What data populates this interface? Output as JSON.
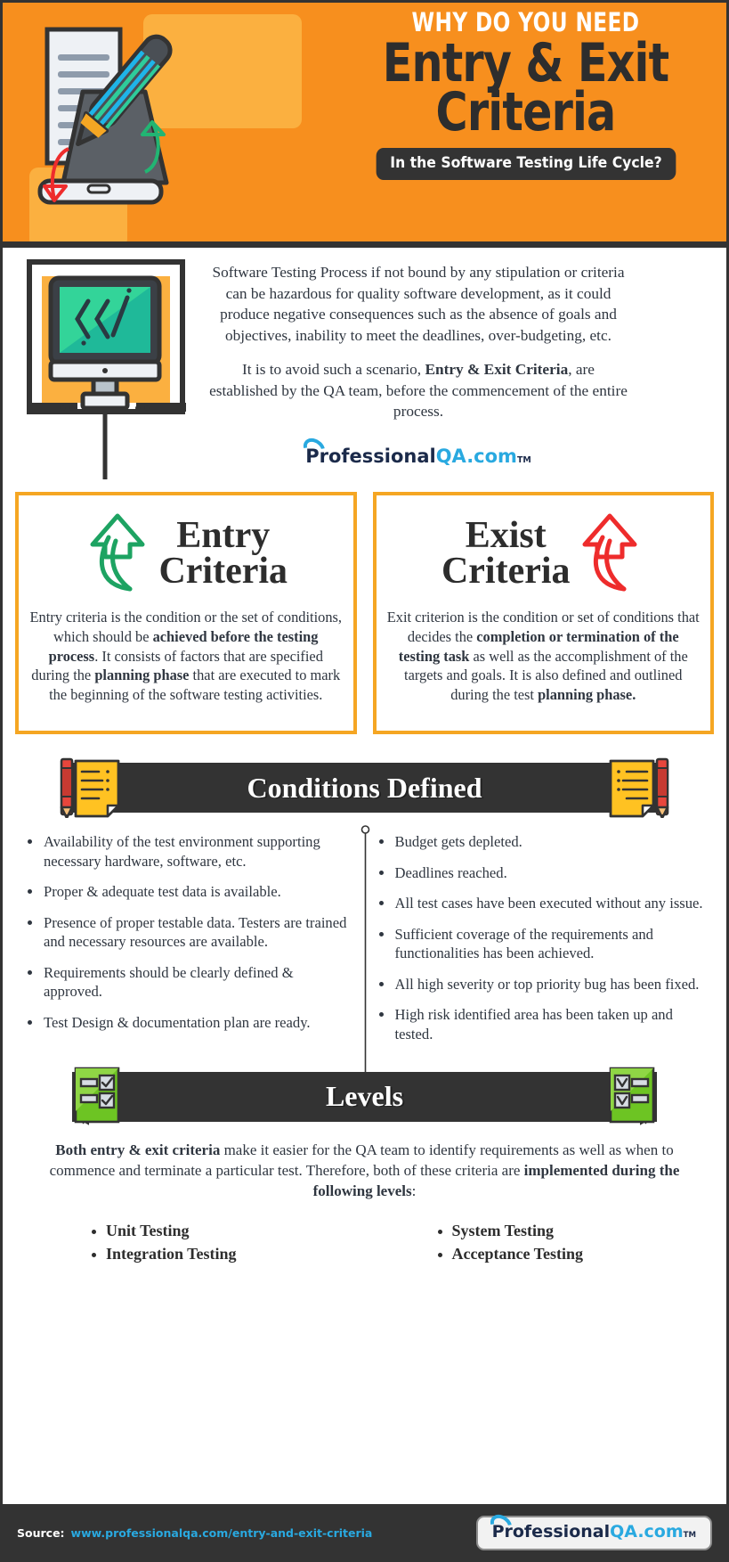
{
  "header": {
    "kicker": "WHY DO YOU NEED",
    "title_line1": "Entry & Exit",
    "title_line2": "Criteria",
    "subtitle": "In the Software Testing Life Cycle?"
  },
  "intro": {
    "paragraph1": "Software Testing Process if not bound by any stipulation or criteria can be hazardous for quality software development, as it could produce negative consequences such as the absence of goals and objectives, inability to meet the deadlines, over-budgeting, etc.",
    "paragraph2_a": "It is to avoid such a scenario, ",
    "paragraph2_bold": "Entry & Exit Criteria",
    "paragraph2_b": ", are established by the QA team, before the commencement of the entire process."
  },
  "logo": {
    "part1": "Professional",
    "part2": "QA.com",
    "tm": "TM"
  },
  "criteria": {
    "entry": {
      "title_line1": "Entry",
      "title_line2": "Criteria",
      "arrow_color": "#1DA362",
      "body_a": "Entry criteria is the condition or the set of conditions, which should be ",
      "body_b1": "achieved before the testing process",
      "body_c": ". It consists of factors that are specified during the ",
      "body_b2": "planning phase",
      "body_d": " that are executed to mark the beginning of the software testing activities."
    },
    "exit": {
      "title_line1": "Exist",
      "title_line2": "Criteria",
      "arrow_color": "#EE2C2C",
      "body_a": "Exit criterion is the condition or set of conditions that decides the ",
      "body_b1": "completion or termination of the testing task",
      "body_c": " as well as the accomplishment of the targets and goals. It is also defined and outlined during the test ",
      "body_b2": "planning phase.",
      "body_d": ""
    }
  },
  "conditions": {
    "banner_title": "Conditions Defined",
    "entry_items": [
      "Availability of the test environment supporting necessary hardware, software, etc.",
      "Proper & adequate test data is available.",
      "Presence of proper testable data. Testers are trained and necessary resources are available.",
      "Requirements should be clearly defined & approved.",
      "Test Design & documentation plan are ready."
    ],
    "exit_items": [
      "Budget gets depleted.",
      "Deadlines reached.",
      "All test cases have been executed without any issue.",
      "Sufficient coverage of the requirements and functionalities has been achieved.",
      "All high severity or top priority bug has been fixed.",
      "High risk identified area has been taken up and tested."
    ]
  },
  "levels": {
    "banner_title": "Levels",
    "intro_bold1": "Both entry & exit criteria",
    "intro_mid": " make it easier for the QA team to identify requirements as well as when to commence and terminate a particular test. Therefore, both of these criteria are ",
    "intro_bold2": "implemented during the following levels",
    "intro_end": ":",
    "left_items": [
      "Unit Testing",
      "Integration Testing"
    ],
    "right_items": [
      "System Testing",
      "Acceptance Testing"
    ]
  },
  "footer": {
    "source_label": "Source:",
    "source_url": "www.professionalqa.com/entry-and-exit-criteria"
  },
  "colors": {
    "orange": "#F78F1E",
    "orange_light": "#FBB040",
    "dark": "#333333",
    "gold_border": "#F5A623",
    "blue": "#29A9E0",
    "navy": "#1b2a4a",
    "green": "#1DA362",
    "red": "#EE2C2C"
  }
}
